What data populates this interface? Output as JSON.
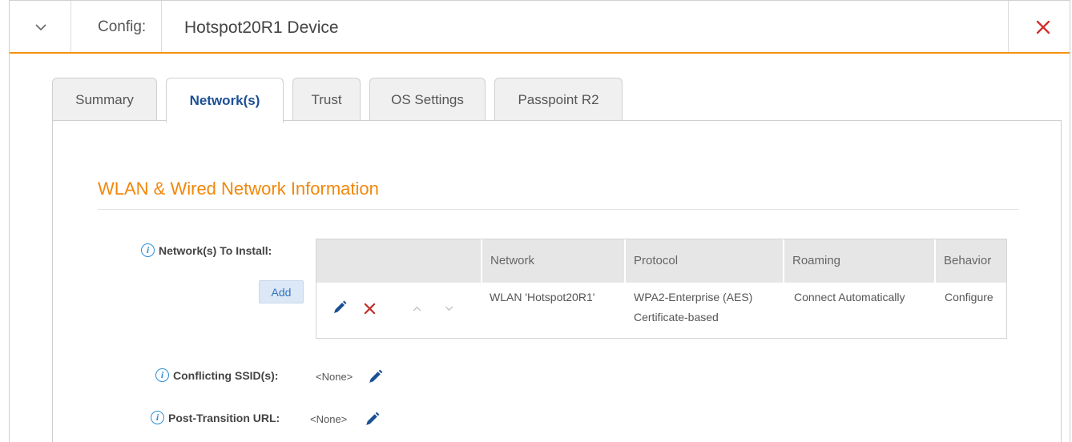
{
  "header": {
    "config_label": "Config:",
    "config_value": "Hotspot20R1 Device",
    "collapse_icon": "chevron-down-icon",
    "close_icon": "close-icon",
    "accent_color": "#f2920f",
    "close_color": "#d0312d"
  },
  "tabs": [
    {
      "label": "Summary",
      "active": false
    },
    {
      "label": "Network(s)",
      "active": true
    },
    {
      "label": "Trust",
      "active": false
    },
    {
      "label": "OS Settings",
      "active": false
    },
    {
      "label": "Passpoint R2",
      "active": false
    }
  ],
  "section": {
    "title": "WLAN & Wired Network Information"
  },
  "networks": {
    "label": "Network(s) To Install:",
    "add_label": "Add",
    "columns": [
      "Network",
      "Protocol",
      "Roaming",
      "Behavior"
    ],
    "rows": [
      {
        "network": "WLAN 'Hotspot20R1'",
        "protocol_line1": "WPA2-Enterprise (AES)",
        "protocol_line2": "Certificate-based",
        "roaming": "Connect Automatically",
        "behavior": "Configure"
      }
    ]
  },
  "conflicting_ssids": {
    "label": "Conflicting SSID(s):",
    "value": "<None>"
  },
  "post_transition_url": {
    "label": "Post-Transition URL:",
    "value": "<None>"
  },
  "info_icon_glyph": "i"
}
